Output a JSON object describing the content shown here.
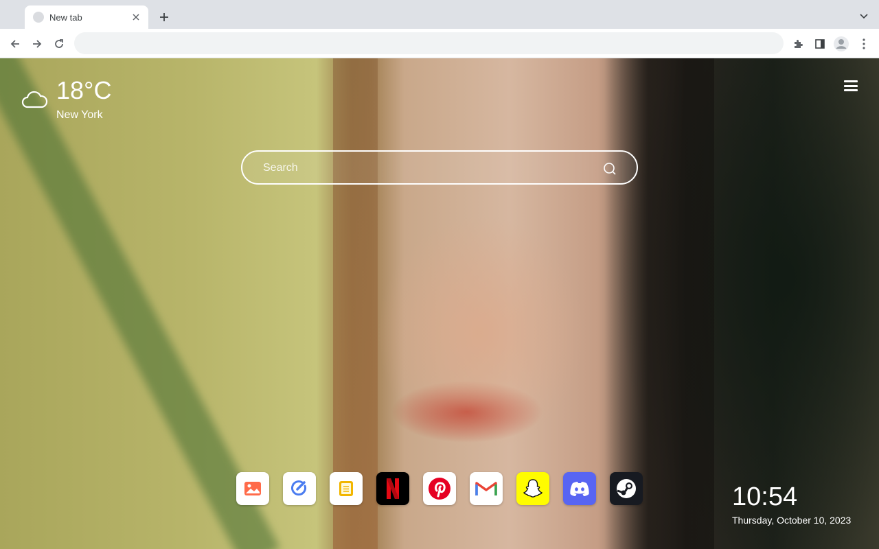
{
  "browser": {
    "tab": {
      "title": "New tab"
    },
    "omnibox": {
      "value": "",
      "placeholder": ""
    },
    "icons": [
      "favicon",
      "close-icon",
      "plus-icon",
      "chevron-down-icon",
      "back-arrow-icon",
      "forward-arrow-icon",
      "reload-icon",
      "puzzle-icon",
      "side-panel-icon",
      "profile-icon",
      "kebab-menu-icon"
    ]
  },
  "ntp": {
    "weather": {
      "temperature": "18°C",
      "city": "New York",
      "icon": "cloud-icon"
    },
    "search": {
      "placeholder": "Search",
      "icon": "search-icon"
    },
    "menu_icon": "hamburger-menu-icon",
    "apps": [
      {
        "name": "Photos",
        "icon": "image-icon",
        "color": "#ff6b4a"
      },
      {
        "name": "Tasks",
        "icon": "check-circle-icon",
        "color": "#4a7cf0"
      },
      {
        "name": "Notes",
        "icon": "notes-icon",
        "color": "#f2b600"
      },
      {
        "name": "Netflix",
        "icon": "netflix-icon",
        "color": "#e50914"
      },
      {
        "name": "Pinterest",
        "icon": "pinterest-icon",
        "color": "#e60023"
      },
      {
        "name": "Gmail",
        "icon": "gmail-icon",
        "color": "#ea4335"
      },
      {
        "name": "Snapchat",
        "icon": "snapchat-icon",
        "color": "#fffc00"
      },
      {
        "name": "Discord",
        "icon": "discord-icon",
        "color": "#5865f2"
      },
      {
        "name": "Steam",
        "icon": "steam-icon",
        "color": "#171a21"
      }
    ],
    "clock": {
      "time": "10:54",
      "date": "Thursday, October 10, 2023"
    }
  }
}
